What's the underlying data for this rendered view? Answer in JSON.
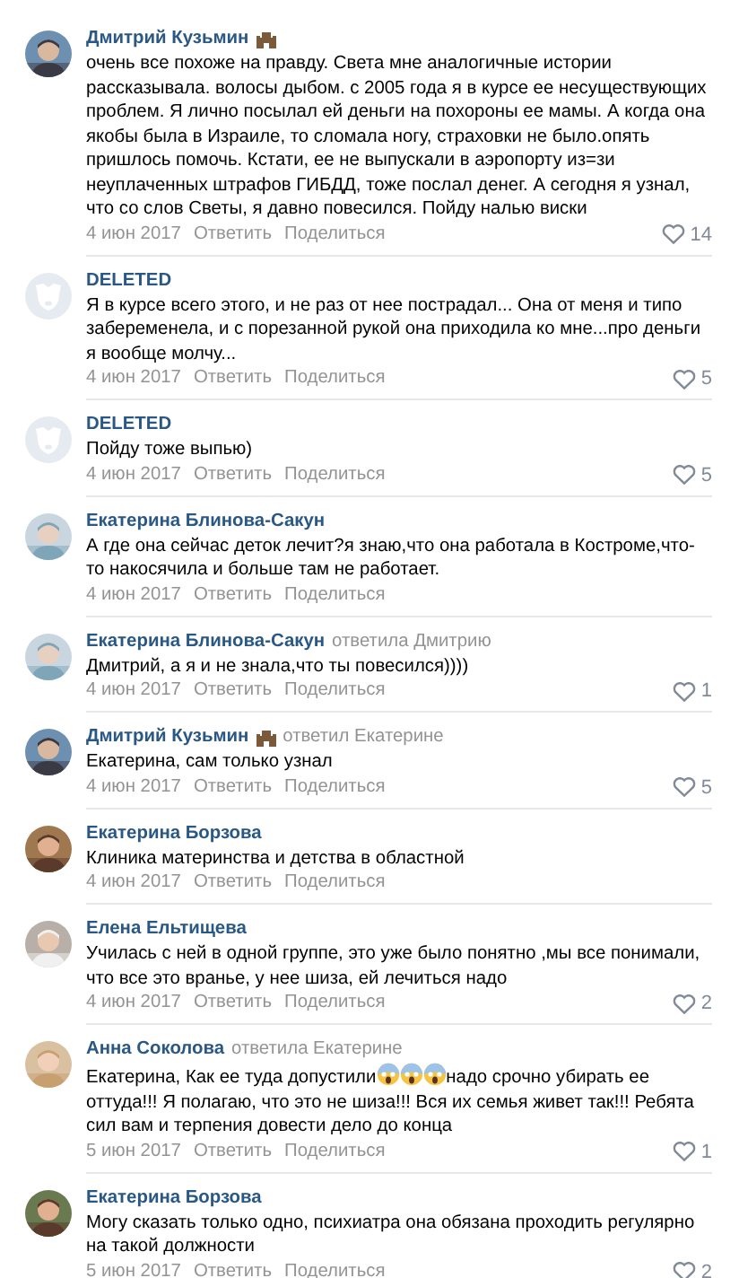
{
  "comments": [
    {
      "author": "Дмитрий Кузьмин",
      "badge": true,
      "avatar": {
        "kind": "picture"
      },
      "text": [
        {
          "kind": "text",
          "text": "очень все похоже на правду. Света мне аналогичные истории рассказывала. волосы дыбом. с 2005 года я в курсе ее несуществующих проблем. Я лично посылал ей деньги на похороны ее мамы. А когда она якобы была в Израиле, то сломала ногу, страховки не было.опять пришлось помочь. Кстати, ее не выпускали в аэропорту из=зи неуплаченных штрафов ГИБДД, тоже послал денег. А сегодня я узнал, что со слов Светы, я давно повесился. Пойду налью виски"
        }
      ],
      "date": "4 июн 2017",
      "actions": [
        "Ответить",
        "Поделиться"
      ],
      "likes": "14"
    },
    {
      "author": "DELETED",
      "badge": false,
      "avatar": {
        "kind": "deleted"
      },
      "text": [
        {
          "kind": "text",
          "text": "Я в курсе всего этого, и не раз от нее пострадал... Она от меня и типо забеременела, и с порезанной рукой она приходила ко мне...про деньги я вообще молчу..."
        }
      ],
      "date": "4 июн 2017",
      "actions": [
        "Ответить",
        "Поделиться"
      ],
      "likes": "5"
    },
    {
      "author": "DELETED",
      "badge": false,
      "avatar": {
        "kind": "deleted"
      },
      "text": [
        {
          "kind": "text",
          "text": "Пойду тоже выпью)"
        }
      ],
      "date": "4 июн 2017",
      "actions": [
        "Ответить",
        "Поделиться"
      ],
      "likes": "5"
    },
    {
      "author": "Екатерина Блинова-Сакун",
      "badge": false,
      "avatar": {
        "kind": "picture"
      },
      "text": [
        {
          "kind": "text",
          "text": "А где она сейчас деток лечит?я знаю,что она работала в Костроме,что-то накосячила и больше там не работает."
        }
      ],
      "date": "4 июн 2017",
      "actions": [
        "Ответить",
        "Поделиться"
      ]
    },
    {
      "author": "Екатерина Блинова-Сакун",
      "badge": false,
      "reply_to": "ответила Дмитрию",
      "avatar": {
        "kind": "picture"
      },
      "text": [
        {
          "kind": "text",
          "text": "Дмитрий, а я и не знала,что ты повесился))))"
        }
      ],
      "date": "4 июн 2017",
      "actions": [
        "Ответить",
        "Поделиться"
      ],
      "likes": "1"
    },
    {
      "author": "Дмитрий Кузьмин",
      "badge": true,
      "reply_to": "ответил Екатерине",
      "avatar": {
        "kind": "picture"
      },
      "text": [
        {
          "kind": "text",
          "text": "Екатерина, сам только узнал"
        }
      ],
      "date": "4 июн 2017",
      "actions": [
        "Ответить",
        "Поделиться"
      ],
      "likes": "5"
    },
    {
      "author": "Екатерина Борзова",
      "badge": false,
      "avatar": {
        "kind": "picture"
      },
      "text": [
        {
          "kind": "text",
          "text": "Клиника материнства и детства в областной"
        }
      ],
      "date": "4 июн 2017",
      "actions": [
        "Ответить",
        "Поделиться"
      ]
    },
    {
      "author": "Елена Ельтищева",
      "badge": false,
      "avatar": {
        "kind": "picture"
      },
      "text": [
        {
          "kind": "text",
          "text": "Училась с ней в одной группе, это уже было понятно ,мы все понимали, что все это вранье, у нее шиза, ей лечиться надо"
        }
      ],
      "date": "4 июн 2017",
      "actions": [
        "Ответить",
        "Поделиться"
      ],
      "likes": "2"
    },
    {
      "author": "Анна Соколова",
      "badge": false,
      "reply_to": "ответила Екатерине",
      "avatar": {
        "kind": "picture"
      },
      "text": [
        {
          "kind": "text",
          "text": "Екатерина, Как ее туда допустили"
        },
        {
          "kind": "emoji"
        },
        {
          "kind": "emoji"
        },
        {
          "kind": "emoji"
        },
        {
          "kind": "text",
          "text": "надо срочно убирать ее оттуда!!! Я полагаю, что это не шиза!!! Вся их семья живет так!!! Ребята сил вам и терпения довести дело до конца"
        }
      ],
      "date": "5 июн 2017",
      "actions": [
        "Ответить",
        "Поделиться"
      ],
      "likes": "1"
    },
    {
      "author": "Екатерина Борзова",
      "badge": false,
      "avatar": {
        "kind": "picture"
      },
      "text": [
        {
          "kind": "text",
          "text": "Могу сказать только одно, психиатра она обязана проходить регулярно на такой должности"
        }
      ],
      "date": "5 июн 2017",
      "actions": [
        "Ответить",
        "Поделиться"
      ],
      "likes": "2"
    }
  ]
}
